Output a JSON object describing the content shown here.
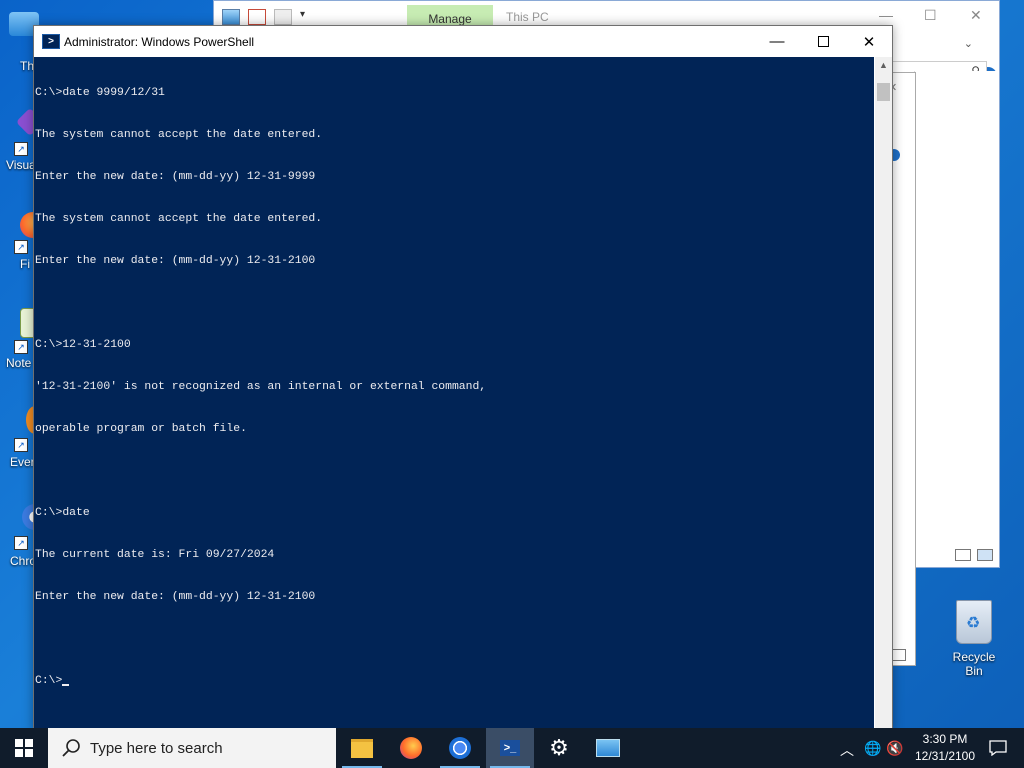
{
  "desktop": {
    "icons": [
      {
        "label": "Th",
        "name": "this-pc"
      },
      {
        "label": "Visua\n2",
        "name": "visual-studio"
      },
      {
        "label": "Fi",
        "name": "firefox"
      },
      {
        "label": "Note",
        "name": "notepad"
      },
      {
        "label": "Ever",
        "name": "everything"
      },
      {
        "label": "Chro",
        "name": "chrome"
      }
    ],
    "recycle_bin_label": "Recycle Bin"
  },
  "explorer": {
    "manage_tab": "Manage",
    "title": "This PC"
  },
  "powershell": {
    "title": "Administrator: Windows PowerShell",
    "lines": [
      "C:\\>date 9999/12/31",
      "The system cannot accept the date entered.",
      "Enter the new date: (mm-dd-yy) 12-31-9999",
      "The system cannot accept the date entered.",
      "Enter the new date: (mm-dd-yy) 12-31-2100",
      "",
      "C:\\>12-31-2100",
      "'12-31-2100' is not recognized as an internal or external command,",
      "operable program or batch file.",
      "",
      "C:\\>date",
      "The current date is: Fri 09/27/2024",
      "Enter the new date: (mm-dd-yy) 12-31-2100",
      ""
    ],
    "prompt": "C:\\>"
  },
  "taskbar": {
    "search_placeholder": "Type here to search",
    "apps": [
      "file-explorer",
      "firefox",
      "chrome",
      "powershell",
      "settings",
      "control-panel"
    ],
    "clock_time": "3:30 PM",
    "clock_date": "12/31/2100"
  },
  "colors": {
    "ps_background": "#012456",
    "ps_text": "#eeedf0",
    "taskbar": "#101c2b"
  }
}
